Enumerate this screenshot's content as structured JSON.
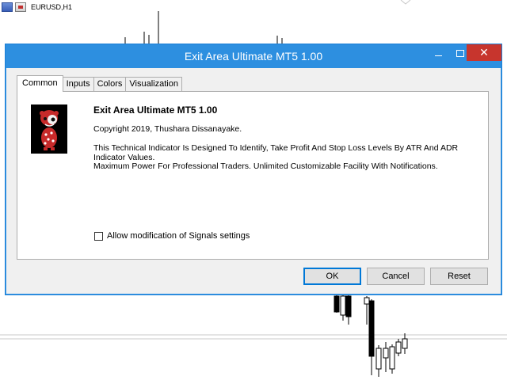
{
  "chart": {
    "symbol": "EURUSD,H1",
    "icons": [
      "chart-window-icon",
      "chart-type-icon"
    ]
  },
  "dialog": {
    "title": "Exit Area Ultimate MT5 1.00",
    "window_buttons": [
      "minimize-icon",
      "maximize-icon",
      "close-icon"
    ],
    "tabs": [
      {
        "label": "Common",
        "active": true
      },
      {
        "label": "Inputs",
        "active": false
      },
      {
        "label": "Colors",
        "active": false
      },
      {
        "label": "Visualization",
        "active": false
      }
    ],
    "common": {
      "name": "Exit Area Ultimate MT5 1.00",
      "copyright": "Copyright 2019, Thushara Dissanayake.",
      "description_line1": "This Technical Indicator Is Designed To Identify, Take Profit And Stop Loss Levels By ATR And ADR Indicator Values.",
      "description_line2": "Maximum Power For Professional Traders. Unlimited Customizable Facility With Notifications.",
      "allow_modification_label": "Allow modification of Signals settings",
      "allow_modification_checked": false
    },
    "buttons": {
      "ok": "OK",
      "cancel": "Cancel",
      "reset": "Reset"
    }
  },
  "colors": {
    "titlebar": "#2d8fe0",
    "close_button": "#c7352d",
    "dialog_bg": "#f0f0f0"
  }
}
